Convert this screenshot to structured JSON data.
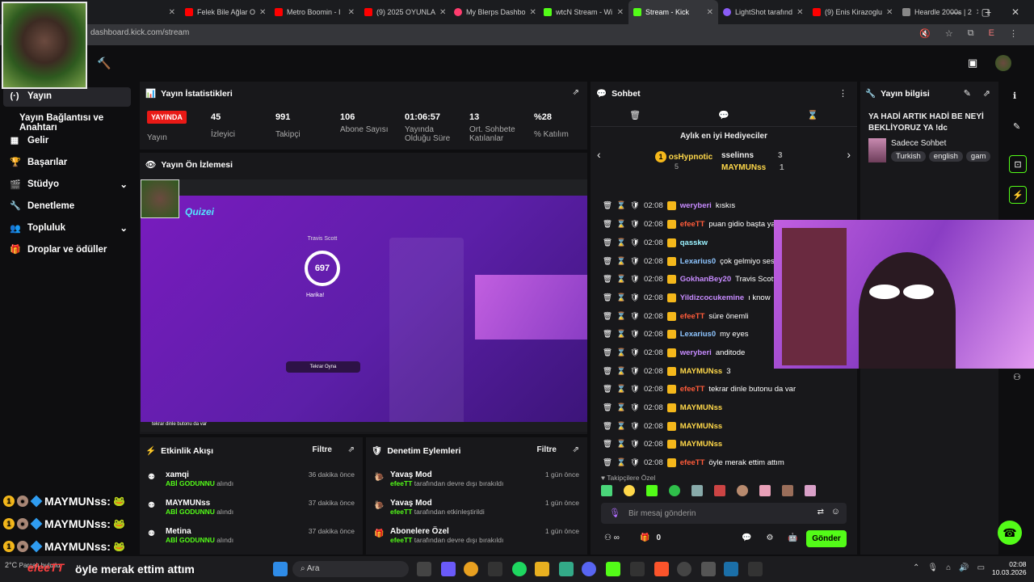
{
  "browser": {
    "tabs": [
      {
        "label": "",
        "color": "#555"
      },
      {
        "label": "Felek Bile Ağlar O",
        "color": "#ff0000"
      },
      {
        "label": "Metro Boomin - I",
        "color": "#ff0000"
      },
      {
        "label": "(9) 2025 OYUNLA",
        "color": "#ff0000"
      },
      {
        "label": "My Blerps Dashbo",
        "color": "#ff3c6e"
      },
      {
        "label": "wtcN Stream - Wi",
        "color": "#53fc18"
      },
      {
        "label": "Stream - Kick",
        "color": "#53fc18"
      },
      {
        "label": "LightShot tarafınd",
        "color": "#8a5cf6"
      },
      {
        "label": "(9) Enis Kirazoglu",
        "color": "#ff0000"
      },
      {
        "label": "Heardle 2000s | 2",
        "color": "#888"
      }
    ],
    "url": "dashboard.kick.com/stream",
    "new_tab": "+"
  },
  "sidebar": {
    "items": [
      {
        "label": "Yayın",
        "icon": "(·)"
      },
      {
        "label": "Yayın Bağlantısı ve Anahtarı",
        "icon": ""
      },
      {
        "label": "Gelir",
        "icon": "▦"
      },
      {
        "label": "Başarılar",
        "icon": "🏆"
      },
      {
        "label": "Stüdyo",
        "icon": "🎬",
        "chevron": "⌄"
      },
      {
        "label": "Denetleme",
        "icon": "🔧"
      },
      {
        "label": "Topluluk",
        "icon": "👥",
        "chevron": "⌄"
      },
      {
        "label": "Droplar ve ödüller",
        "icon": "🎁"
      }
    ]
  },
  "stats": {
    "title": "Yayın İstatistikleri",
    "live": "YAYINDA",
    "live_sub": "Yayın",
    "items": [
      {
        "value": "45",
        "label": "İzleyici"
      },
      {
        "value": "991",
        "label": "Takipçi"
      },
      {
        "value": "106",
        "label": "Abone Sayısı"
      },
      {
        "value": "01:06:57",
        "label": "Yayında Olduğu Süre"
      },
      {
        "value": "13",
        "label": "Ort. Sohbete Katılanlar"
      },
      {
        "value": "%28",
        "label": "% Katılım"
      }
    ]
  },
  "preview": {
    "title": "Yayın Ön İzlemesi",
    "brand": "Quizei",
    "artist": "Travis Scott",
    "score": "697",
    "result": "Harika!",
    "again": "Tekrar Oyna",
    "caption": "tekrar dinle butonu da var"
  },
  "activity": {
    "title": "Etkinlik Akışı",
    "filter": "Filtre",
    "items": [
      {
        "name": "xamqi",
        "sub": "ABİ GODUNNU",
        "suffix": "alındı",
        "time": "36 dakika önce"
      },
      {
        "name": "MAYMUNss",
        "sub": "ABİ GODUNNU",
        "suffix": "alındı",
        "time": "37 dakika önce"
      },
      {
        "name": "Metina",
        "sub": "ABİ GODUNNU",
        "suffix": "alındı",
        "time": "37 dakika önce"
      }
    ]
  },
  "moderation": {
    "title": "Denetim Eylemleri",
    "filter": "Filtre",
    "items": [
      {
        "name": "Yavaş Mod",
        "user": "efeeTT",
        "suffix": "tarafından devre dışı bırakıldı",
        "time": "1 gün önce"
      },
      {
        "name": "Yavaş Mod",
        "user": "efeeTT",
        "suffix": "tarafından etkinleştirildi",
        "time": "1 gün önce"
      },
      {
        "name": "Abonelere Özel",
        "user": "efeeTT",
        "suffix": "tarafından devre dışı bırakıldı",
        "time": "1 gün önce"
      }
    ]
  },
  "chat": {
    "title": "Sohbet",
    "gifters_title": "Aylık en iyi Hediyeciler",
    "gifters": [
      {
        "name": "osHypnotic",
        "count": "5"
      },
      {
        "name": "sselinns",
        "count": "3"
      },
      {
        "name": "MAYMUNss",
        "count": "1"
      }
    ],
    "messages": [
      {
        "time": "02:08",
        "user": "weryberi",
        "color": "#c78bff",
        "text": "kıskıs"
      },
      {
        "time": "02:08",
        "user": "efeeTT",
        "color": "#ff5b3a",
        "text": "puan gidio başta yapsaydık keşke"
      },
      {
        "time": "02:08",
        "user": "qasskw",
        "color": "#9bf2ff",
        "text": ""
      },
      {
        "time": "02:08",
        "user": "Lexarius0",
        "color": "#8ec5ff",
        "text": "çok gelmiyo ses"
      },
      {
        "time": "02:08",
        "user": "GokhanBey20",
        "color": "#c78bff",
        "text": "Travis Scott ın kendi"
      },
      {
        "time": "02:08",
        "user": "Yildizcocukemine",
        "color": "#c78bff",
        "text": "ı know"
      },
      {
        "time": "02:08",
        "user": "efeeTT",
        "color": "#ff5b3a",
        "text": "süre önemli"
      },
      {
        "time": "02:08",
        "user": "Lexarius0",
        "color": "#8ec5ff",
        "text": "my eyes"
      },
      {
        "time": "02:08",
        "user": "weryberi",
        "color": "#c78bff",
        "text": "anditode"
      },
      {
        "time": "02:08",
        "user": "MAYMUNss",
        "color": "#ffd84a",
        "text": "3"
      },
      {
        "time": "02:08",
        "user": "efeeTT",
        "color": "#ff5b3a",
        "text": "tekrar dinle butonu da var"
      },
      {
        "time": "02:08",
        "user": "MAYMUNss",
        "color": "#ffd84a",
        "text": ""
      },
      {
        "time": "02:08",
        "user": "MAYMUNss",
        "color": "#ffd84a",
        "text": ""
      },
      {
        "time": "02:08",
        "user": "MAYMUNss",
        "color": "#ffd84a",
        "text": ""
      },
      {
        "time": "02:08",
        "user": "efeeTT",
        "color": "#ff5b3a",
        "text": "öyle merak ettim attım"
      }
    ],
    "followers_label": "Takipçilere Özel",
    "placeholder": "Bir mesaj gönderin",
    "send": "Gönder",
    "count": "0"
  },
  "info": {
    "title": "Yayın bilgisi",
    "stream_title": "YA HADİ ARTIK HADİ BE NEYİ BEKLİYORUZ YA !dc",
    "category": "Sadece Sohbet",
    "tags": [
      "Turkish",
      "english",
      "gam"
    ]
  },
  "overlay": {
    "user": "MAYMUNss:",
    "caption_user": "efeeTT",
    "caption": "öyle merak ettim attım"
  },
  "taskbar": {
    "search": "Ara",
    "time": "02:08",
    "date": "10.03.2026",
    "weather": "2°C",
    "weather_sub": "Parçalı bulutlu"
  },
  "colors": {
    "accent": "#53fc18",
    "live": "#e91916",
    "panel": "#18181b"
  }
}
